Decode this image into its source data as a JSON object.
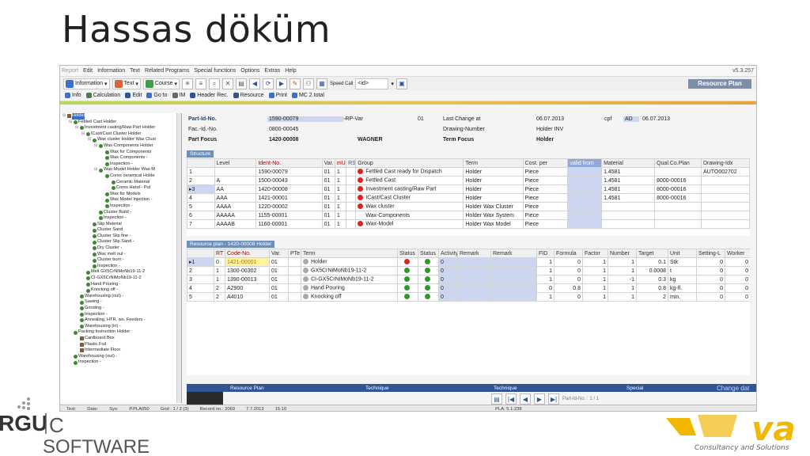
{
  "slide_title": "Hassas döküm",
  "menu": {
    "items": [
      "Report",
      "Edit",
      "Information",
      "Text",
      "Related Programs",
      "Special functions",
      "Options",
      "Extras",
      "Help"
    ],
    "version": "v5.3.257"
  },
  "toolbar1": {
    "information": "Information",
    "text": "Text",
    "course": "Course",
    "speed_call": "Speed Call",
    "speed_call_value": "<id>",
    "resource_plan_title": "Resource Plan"
  },
  "toolbar2": [
    "Info",
    "Calculation",
    "Edit",
    "Go to",
    "IM",
    "Header Rec.",
    "Resource",
    "Print",
    "MC 2 total"
  ],
  "tree": [
    {
      "indent": 0,
      "label": "Holder",
      "box": true
    },
    {
      "indent": 1,
      "label": "Fettled Cast Holder"
    },
    {
      "indent": 2,
      "label": "Investment casting/Raw Part Holder"
    },
    {
      "indent": 3,
      "label": "ICast/Cast Cluster Holder"
    },
    {
      "indent": 4,
      "label": "Wax cluster Holder Wax Clust"
    },
    {
      "indent": 5,
      "label": "Wax-Components Holder"
    },
    {
      "indent": 6,
      "label": "Wax for Components"
    },
    {
      "indent": 6,
      "label": "Wax Components -"
    },
    {
      "indent": 6,
      "label": "Inspection -"
    },
    {
      "indent": 5,
      "label": "Wax-Model Holder Wax M"
    },
    {
      "indent": 6,
      "label": "Cores ceramical Holde"
    },
    {
      "indent": 7,
      "label": "Ceramic Material"
    },
    {
      "indent": 7,
      "label": "Cores Hand - Put"
    },
    {
      "indent": 6,
      "label": "Wax for Models"
    },
    {
      "indent": 6,
      "label": "Wax Model Injection -"
    },
    {
      "indent": 6,
      "label": "Inspection -"
    },
    {
      "indent": 5,
      "label": "Cluster Build -"
    },
    {
      "indent": 5,
      "label": "Inspection -"
    },
    {
      "indent": 4,
      "label": "Slip Material"
    },
    {
      "indent": 4,
      "label": "Cluster Sand"
    },
    {
      "indent": 4,
      "label": "Cluster Slip fine -"
    },
    {
      "indent": 4,
      "label": "Cluster Slip Sand -"
    },
    {
      "indent": 4,
      "label": "Dry Cluster -"
    },
    {
      "indent": 4,
      "label": "Wax melt out -"
    },
    {
      "indent": 4,
      "label": "Cluster burn -"
    },
    {
      "indent": 4,
      "label": "Inspection -"
    },
    {
      "indent": 3,
      "label": "Melt GX5CrNiMoNb19-11-2"
    },
    {
      "indent": 3,
      "label": "CI-GX5CrNiMoNb19-11-2"
    },
    {
      "indent": 3,
      "label": "Hand Pouring -"
    },
    {
      "indent": 3,
      "label": "Knocking off -"
    },
    {
      "indent": 2,
      "label": "Warehousing (out) -"
    },
    {
      "indent": 2,
      "label": "Sawing -"
    },
    {
      "indent": 2,
      "label": "Grinding -"
    },
    {
      "indent": 2,
      "label": "Inspection -"
    },
    {
      "indent": 2,
      "label": "Annealing, HTR. wo. Feeders -"
    },
    {
      "indent": 2,
      "label": "Warehousing (in) -"
    },
    {
      "indent": 1,
      "label": "Packing Instruction Holder"
    },
    {
      "indent": 2,
      "label": "Cardboard Box",
      "box": true
    },
    {
      "indent": 2,
      "label": "Plastic Foil",
      "box": true
    },
    {
      "indent": 2,
      "label": "Intermediate Floor",
      "box": true
    },
    {
      "indent": 1,
      "label": "Warehousing (out) -"
    },
    {
      "indent": 1,
      "label": "Inspection -"
    }
  ],
  "header": {
    "part_id_label": "Part-Id-No.",
    "part_id_value": "1590-00079",
    "rp_var_label": "RP-Var",
    "rp_var_value": "01",
    "last_change_label": "Last Change at",
    "last_change_date": "06.07.2013",
    "last_change_user": "cpf",
    "cpf_code": "AD",
    "cpf_date": "06.07.2013",
    "fac_id_label": "Fac.-Id.-No.",
    "fac_id_value": "0800-00045",
    "drawing_label": "Drawing-Number",
    "drawing_value": "Holder INV",
    "part_focus_label": "Part Focus",
    "part_focus_value": "1420-00008",
    "part_focus_name": "WAGNER",
    "term_focus_label": "Term Focus",
    "term_focus_value": "Holder"
  },
  "structure": {
    "title": "Structure",
    "columns": [
      "",
      "Level",
      "Ident-No.",
      "Var.",
      "mU",
      "RS",
      "Group",
      "Term",
      "Cost. per",
      "valid from",
      "Material",
      "Qual.Co.Plan",
      "Drawing-Idx"
    ],
    "rows": [
      {
        "n": "1",
        "level": "",
        "ident": "1590-00079",
        "var": "01",
        "mu": "1",
        "dot": "red",
        "group": "Fettled Cast ready for Dispatch",
        "term": "Holder",
        "cost": "Piece",
        "valid": "",
        "material": "1.4581",
        "qual": "",
        "drawing": "AUTO002702"
      },
      {
        "n": "2",
        "level": "A",
        "ident": "1500-00043",
        "var": "01",
        "mu": "1",
        "dot": "red",
        "group": "Fettled Cast",
        "term": "Holder",
        "cost": "Piece",
        "valid": "",
        "material": "1.4581",
        "qual": "8000-00016",
        "drawing": ""
      },
      {
        "n": "▸3",
        "level": "AA",
        "ident": "1420-00008",
        "var": "01",
        "mu": "1",
        "dot": "red",
        "group": "Investment casting/Raw Part",
        "term": "Holder",
        "cost": "Piece",
        "valid": "",
        "material": "1.4581",
        "qual": "8000-00016",
        "drawing": ""
      },
      {
        "n": "4",
        "level": "AAA",
        "ident": "1421-00001",
        "var": "01",
        "mu": "1",
        "dot": "red",
        "group": "ICast/Cast Cluster",
        "term": "Holder",
        "cost": "Piece",
        "valid": "",
        "material": "1.4581",
        "qual": "8000-00016",
        "drawing": ""
      },
      {
        "n": "5",
        "level": "AAAA",
        "ident": "1220-00002",
        "var": "01",
        "mu": "1",
        "dot": "red",
        "group": "Wax cluster",
        "term": "Holder Wax Cluster",
        "cost": "Piece",
        "valid": "",
        "material": "",
        "qual": "",
        "drawing": ""
      },
      {
        "n": "6",
        "level": "AAAAA",
        "ident": "1155-00001",
        "var": "01",
        "mu": "1",
        "dot": "",
        "group": "Wax-Components",
        "term": "Holder Wax System",
        "cost": "Piece",
        "valid": "",
        "material": "",
        "qual": "",
        "drawing": ""
      },
      {
        "n": "7",
        "level": "AAAAB",
        "ident": "1160-00001",
        "var": "01",
        "mu": "1",
        "dot": "red",
        "group": "Wax-Model",
        "term": "Holder Wax Model",
        "cost": "Piece",
        "valid": "",
        "material": "",
        "qual": "",
        "drawing": ""
      }
    ]
  },
  "resource_plan": {
    "title": "Resource plan - 1420-00008 Holder",
    "columns": [
      "",
      "RT",
      "Code-No.",
      "Var.",
      "PTe",
      "Term",
      "Status",
      "Status",
      "Activity",
      "Remark",
      "Remark",
      "FID",
      "Formula",
      "Factor",
      "Number",
      "Target",
      "Unit",
      "Setting-L",
      "Worker"
    ],
    "rows": [
      {
        "n": "▸1",
        "rt": "0",
        "code": "1421-00001",
        "var": "01",
        "term": "Holder",
        "s1": "red",
        "s2": "green",
        "act": "0",
        "fid": "1",
        "formula": "0",
        "factor": "1",
        "number": "1",
        "target": "0.1",
        "unit": "Stk",
        "setting": "0",
        "worker": "0"
      },
      {
        "n": "2",
        "rt": "1",
        "code": "1300-00302",
        "var": "01",
        "term": "GX5CrNiMoNb19-11-2",
        "s1": "green",
        "s2": "green",
        "act": "0",
        "fid": "1",
        "formula": "0",
        "factor": "1",
        "number": "1",
        "target": "0.0008",
        "unit": "t",
        "setting": "0",
        "worker": "0"
      },
      {
        "n": "3",
        "rt": "1",
        "code": "1390-00013",
        "var": "01",
        "term": "CI-GX5CrNiMoNb19-11-2",
        "s1": "green",
        "s2": "green",
        "act": "0",
        "fid": "1",
        "formula": "0",
        "factor": "1",
        "number": "-1",
        "target": "0.3",
        "unit": "kg",
        "setting": "0",
        "worker": "0"
      },
      {
        "n": "4",
        "rt": "2",
        "code": "A2900",
        "var": "01",
        "term": "Hand Pouring",
        "s1": "green",
        "s2": "green",
        "act": "0",
        "fid": "0",
        "formula": "0.8",
        "factor": "1",
        "number": "1",
        "target": "0.8",
        "unit": "kg-fl.",
        "setting": "0",
        "worker": "0"
      },
      {
        "n": "5",
        "rt": "2",
        "code": "A4010",
        "var": "01",
        "term": "Knocking off",
        "s1": "green",
        "s2": "green",
        "act": "0",
        "fid": "1",
        "formula": "0",
        "factor": "1",
        "number": "1",
        "target": "2",
        "unit": "min.",
        "setting": "0",
        "worker": "0"
      }
    ]
  },
  "bottom_tabs": [
    "Resource Plan",
    "Technique",
    "Technique",
    "Special",
    "Change dat"
  ],
  "nav_label": "Part-Id-No. : 1 / 1",
  "statusbar": [
    "Text:",
    "Date:",
    "Sys:",
    "P.PLA050",
    "Grid : 1 / 2 (3)",
    "Record no.: 2069",
    "7.7.2013",
    "15:10",
    "PLA: 5.1.238"
  ],
  "logo_left": {
    "line1": "RGU",
    "line2": "SOFTWARE"
  },
  "logo_right": {
    "brand": "va",
    "tagline": "Consultancy and Solutions"
  },
  "colors": {
    "header_blue": "#2f5597",
    "accent_orange": "#e8a33a",
    "logo_yellow": "#f2b800"
  }
}
